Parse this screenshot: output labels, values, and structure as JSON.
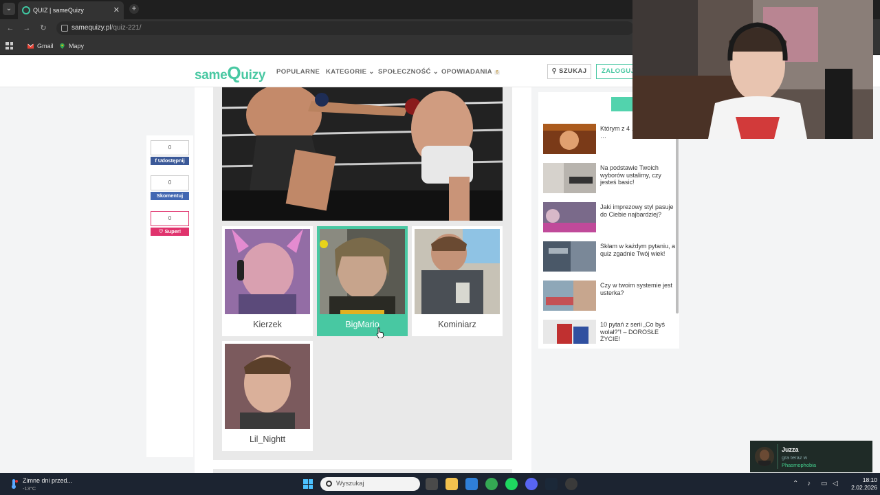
{
  "browser": {
    "tab_title": "QUIZ | sameQuizy",
    "tab_close": "✕",
    "new_tab": "+",
    "url_host": "samequizy.pl",
    "url_path": "/quiz-221/",
    "bookmarks": [
      {
        "label": "Gmail"
      },
      {
        "label": "Mapy"
      }
    ]
  },
  "site": {
    "logo_part1": "same",
    "logo_part2": "Q",
    "logo_part3": "uizy",
    "nav": [
      {
        "label": "POPULARNE"
      },
      {
        "label": "KATEGORIE ⌄"
      },
      {
        "label": "SPOŁECZNOŚĆ ⌄"
      },
      {
        "label": "OPOWIADANIA",
        "badge": "6"
      }
    ],
    "search_label": "⚲ SZUKAJ",
    "login_label": "ZALOGUJ"
  },
  "share": {
    "facebook": {
      "count": "0",
      "label": "f Udostępnij",
      "color": "#3b5998"
    },
    "comment": {
      "count": "0",
      "label": "Skomentuj",
      "color": "#4267b2"
    },
    "like": {
      "count": "0",
      "label": "♡ Super!",
      "color": "#e0336d"
    }
  },
  "quiz": {
    "answers": [
      {
        "name": "Kierzek",
        "selected": false
      },
      {
        "name": "BigMario",
        "selected": true
      },
      {
        "name": "Kominiarz",
        "selected": false
      },
      {
        "name": "Lil_Nightt",
        "selected": false
      }
    ]
  },
  "sidebar": {
    "items": [
      {
        "title": "Którym z 4 … powinieneś …"
      },
      {
        "title": "Na podstawie Twoich wyborów ustalimy, czy jesteś basic!"
      },
      {
        "title": "Jaki imprezowy styl pasuje do Ciebie najbardziej?"
      },
      {
        "title": "Skłam w każdym pytaniu, a quiz zgadnie Twój wiek!"
      },
      {
        "title": "Czy w twoim systemie jest usterka?"
      },
      {
        "title": "10 pytań z serii „Co byś wolał?”! – DOROSŁE ŻYCIE!"
      }
    ]
  },
  "notification": {
    "name": "Juzza",
    "subtitle": "gra teraz w",
    "game": "Phasmophobia"
  },
  "taskbar": {
    "weather_title": "Zimne dni przed...",
    "weather_temp": "-13°C",
    "search_placeholder": "Wyszukaj",
    "time": "18:10",
    "date": "2.02.2026"
  },
  "colors": {
    "brand": "#48c8a2",
    "selected_answer": "#48c8a2",
    "taskbar": "#1c2431"
  }
}
